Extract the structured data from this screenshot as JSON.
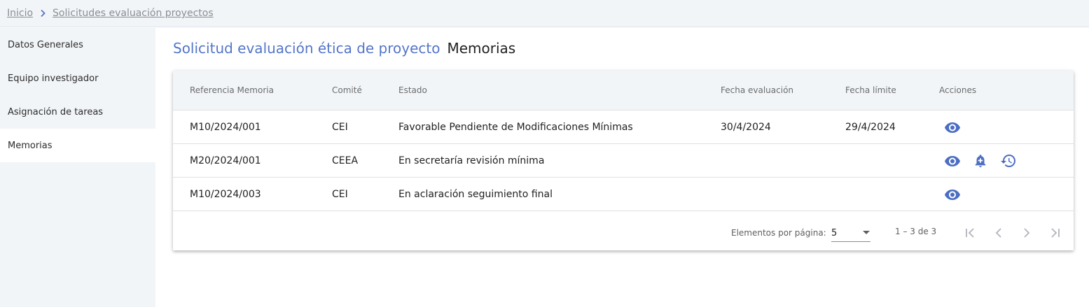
{
  "breadcrumb": {
    "home": "Inicio",
    "current": "Solicitudes evaluación proyectos"
  },
  "sidebar": {
    "items": [
      {
        "label": "Datos Generales"
      },
      {
        "label": "Equipo investigador"
      },
      {
        "label": "Asignación de tareas"
      },
      {
        "label": "Memorias"
      }
    ],
    "active_index": 3
  },
  "heading": {
    "title": "Solicitud evaluación ética de proyecto",
    "section": "Memorias"
  },
  "table": {
    "columns": [
      "Referencia Memoria",
      "Comité",
      "Estado",
      "Fecha evaluación",
      "Fecha límite",
      "Acciones"
    ],
    "rows": [
      {
        "referencia": "M10/2024/001",
        "comite": "CEI",
        "estado": "Favorable Pendiente de Modificaciones Mínimas",
        "fecha_evaluacion": "30/4/2024",
        "fecha_limite": "29/4/2024",
        "actions": [
          "eye-icon"
        ]
      },
      {
        "referencia": "M20/2024/001",
        "comite": "CEEA",
        "estado": "En secretaría revisión mínima",
        "fecha_evaluacion": "",
        "fecha_limite": "",
        "actions": [
          "eye-icon",
          "bell-plus-icon",
          "history-icon"
        ]
      },
      {
        "referencia": "M10/2024/003",
        "comite": "CEI",
        "estado": "En aclaración seguimiento final",
        "fecha_evaluacion": "",
        "fecha_limite": "",
        "actions": [
          "eye-icon"
        ]
      }
    ]
  },
  "paginator": {
    "label": "Elementos por página:",
    "page_size": "5",
    "range": "1 – 3 de 3"
  },
  "colors": {
    "accent": "#5476c9",
    "panel": "#f2f5f8",
    "icon": "#4b6ec3"
  }
}
